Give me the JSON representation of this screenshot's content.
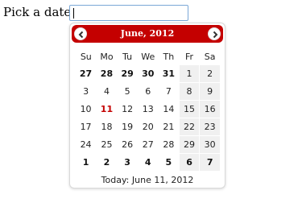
{
  "form": {
    "label": "Pick a date:",
    "input_value": ""
  },
  "calendar": {
    "title": "June, 2012",
    "weekdays": [
      "Su",
      "Mo",
      "Tu",
      "We",
      "Th",
      "Fr",
      "Sa"
    ],
    "weeks": [
      [
        "27",
        "28",
        "29",
        "30",
        "31",
        "1",
        "2"
      ],
      [
        "3",
        "4",
        "5",
        "6",
        "7",
        "8",
        "9"
      ],
      [
        "10",
        "11",
        "12",
        "13",
        "14",
        "15",
        "16"
      ],
      [
        "17",
        "18",
        "19",
        "20",
        "21",
        "22",
        "23"
      ],
      [
        "24",
        "25",
        "26",
        "27",
        "28",
        "29",
        "30"
      ],
      [
        "1",
        "2",
        "3",
        "4",
        "5",
        "6",
        "7"
      ]
    ],
    "today_label": "Today: June 11, 2012"
  },
  "colors": {
    "header_bg": "#c40000",
    "today_text": "#c40000",
    "input_border": "#7aa7d6"
  },
  "icons": {
    "prev": "chevron-left-icon",
    "next": "chevron-right-icon"
  }
}
